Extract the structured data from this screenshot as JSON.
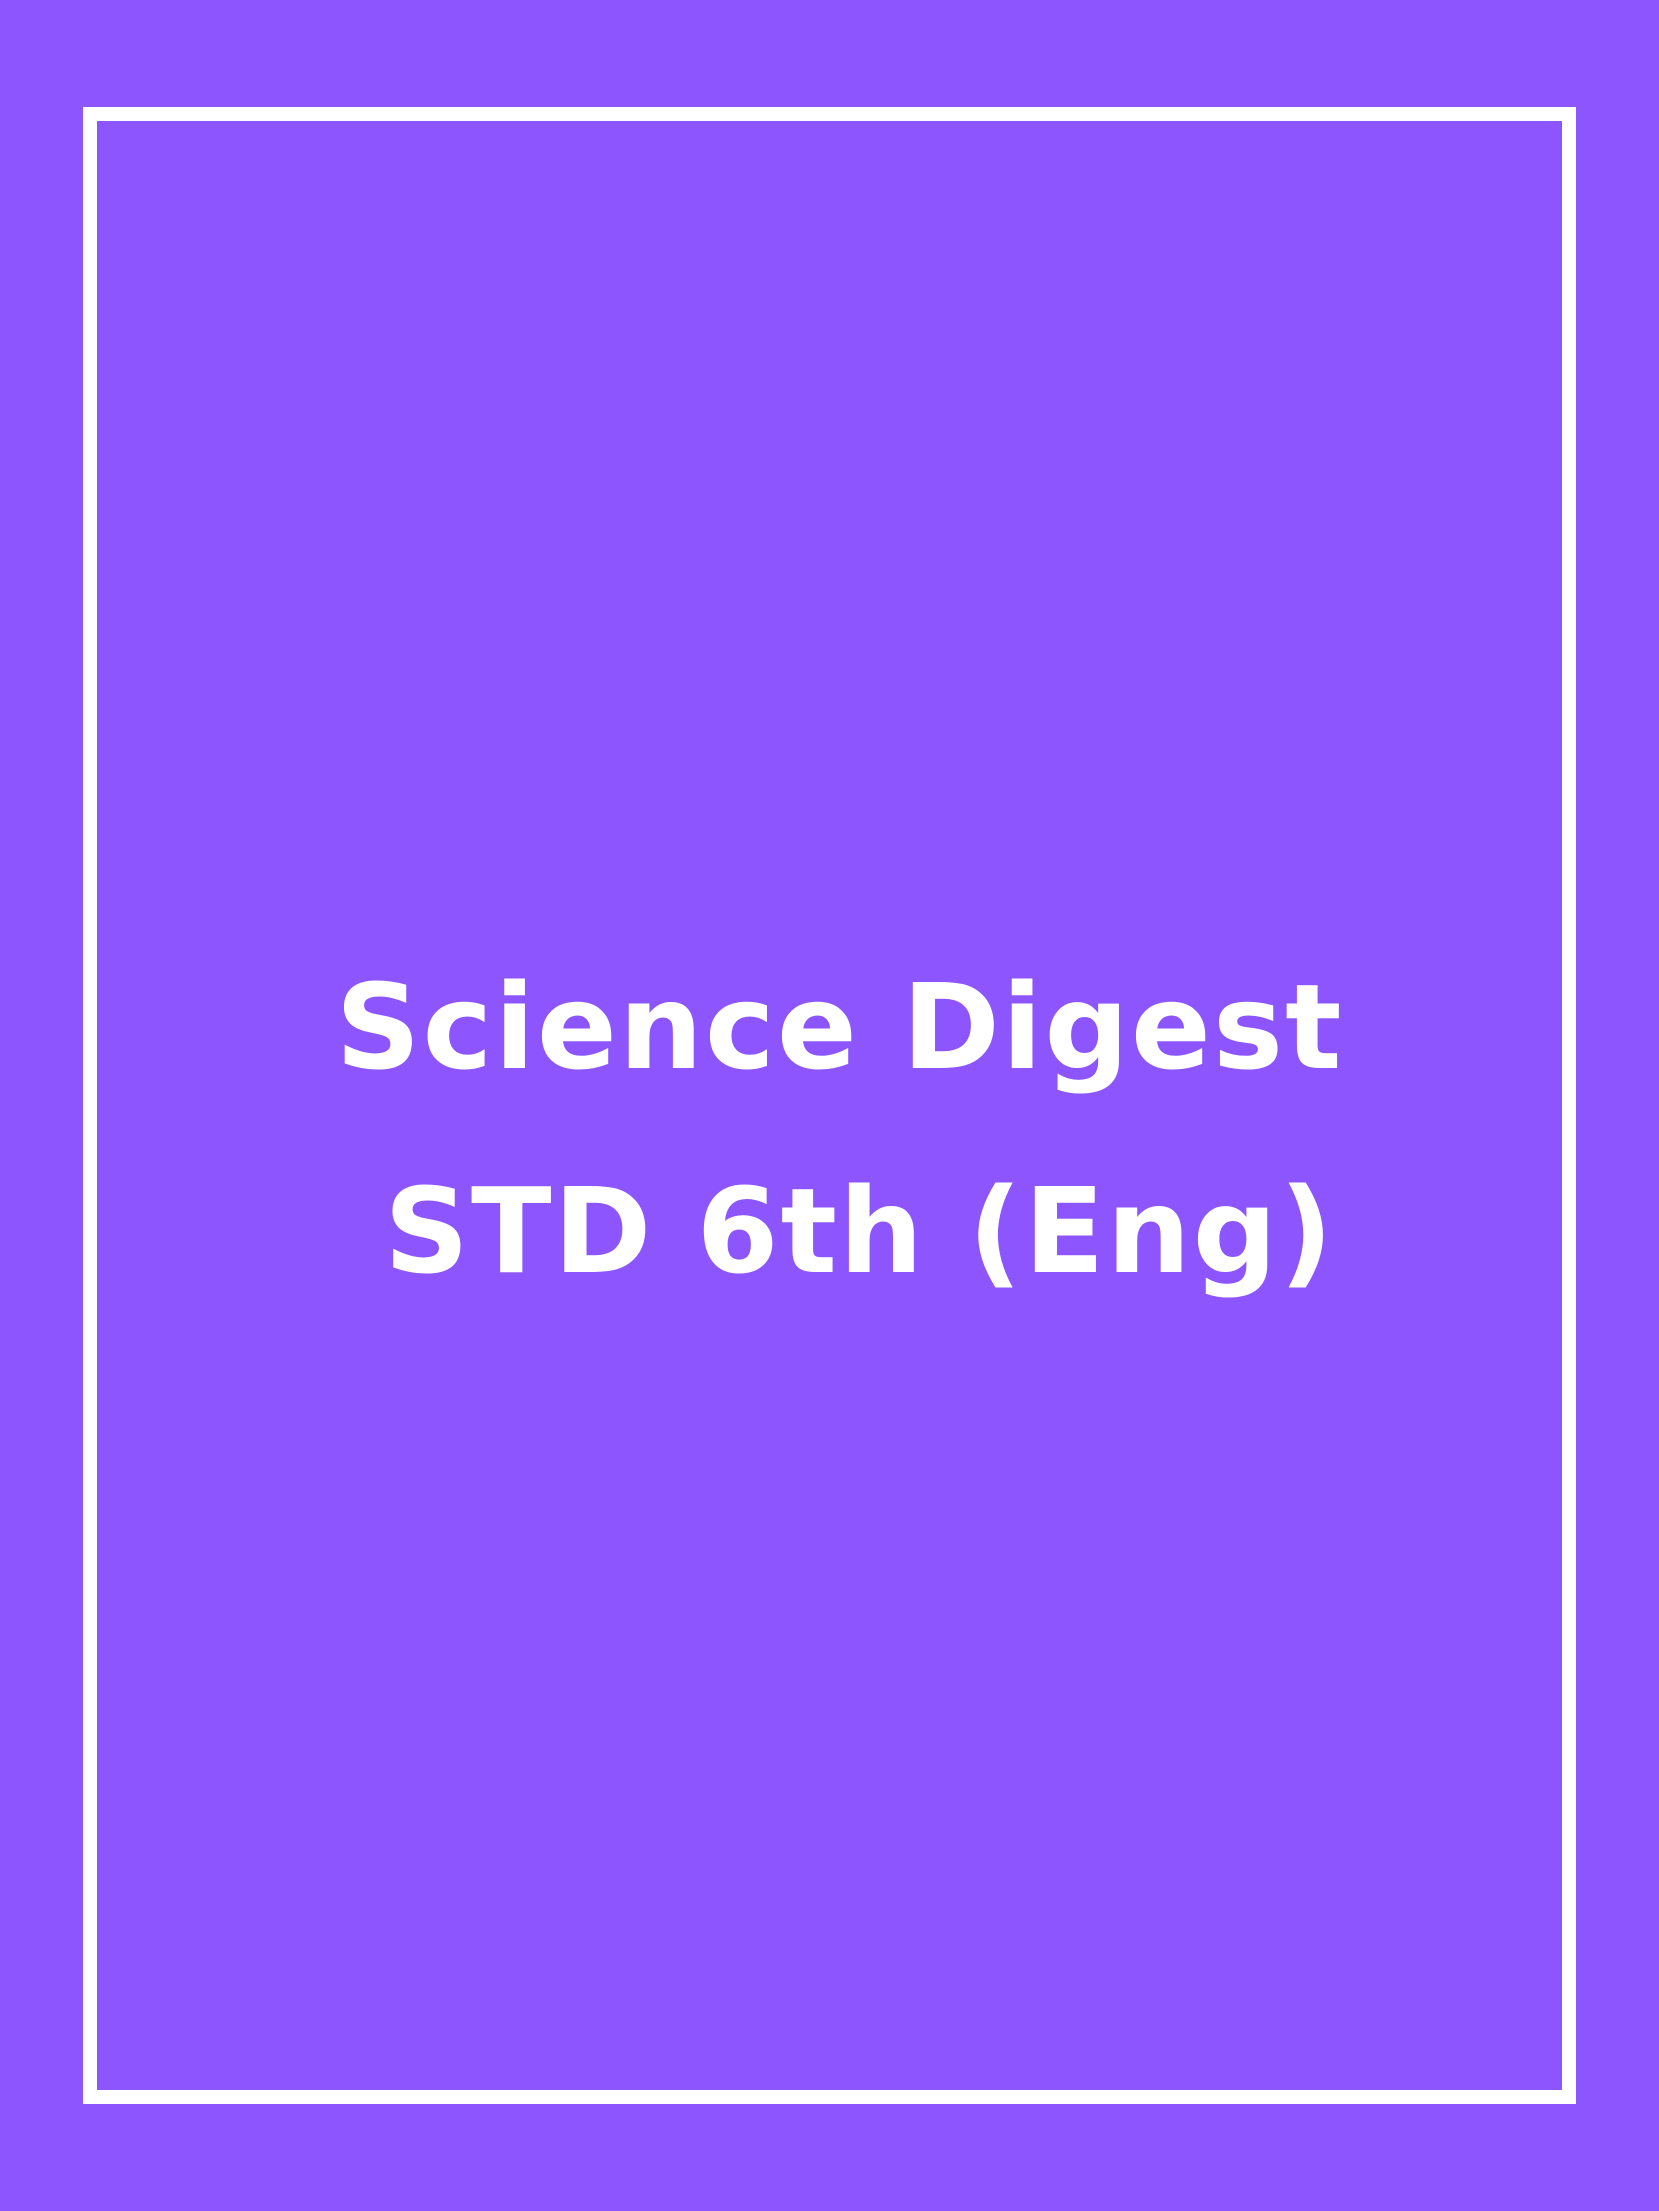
{
  "cover": {
    "background_color": "#8c55fe",
    "frame_color": "#ffffff",
    "text_color": "#ffffff",
    "title_line1": "Science Digest",
    "title_line2": "STD 6th (Eng)"
  }
}
